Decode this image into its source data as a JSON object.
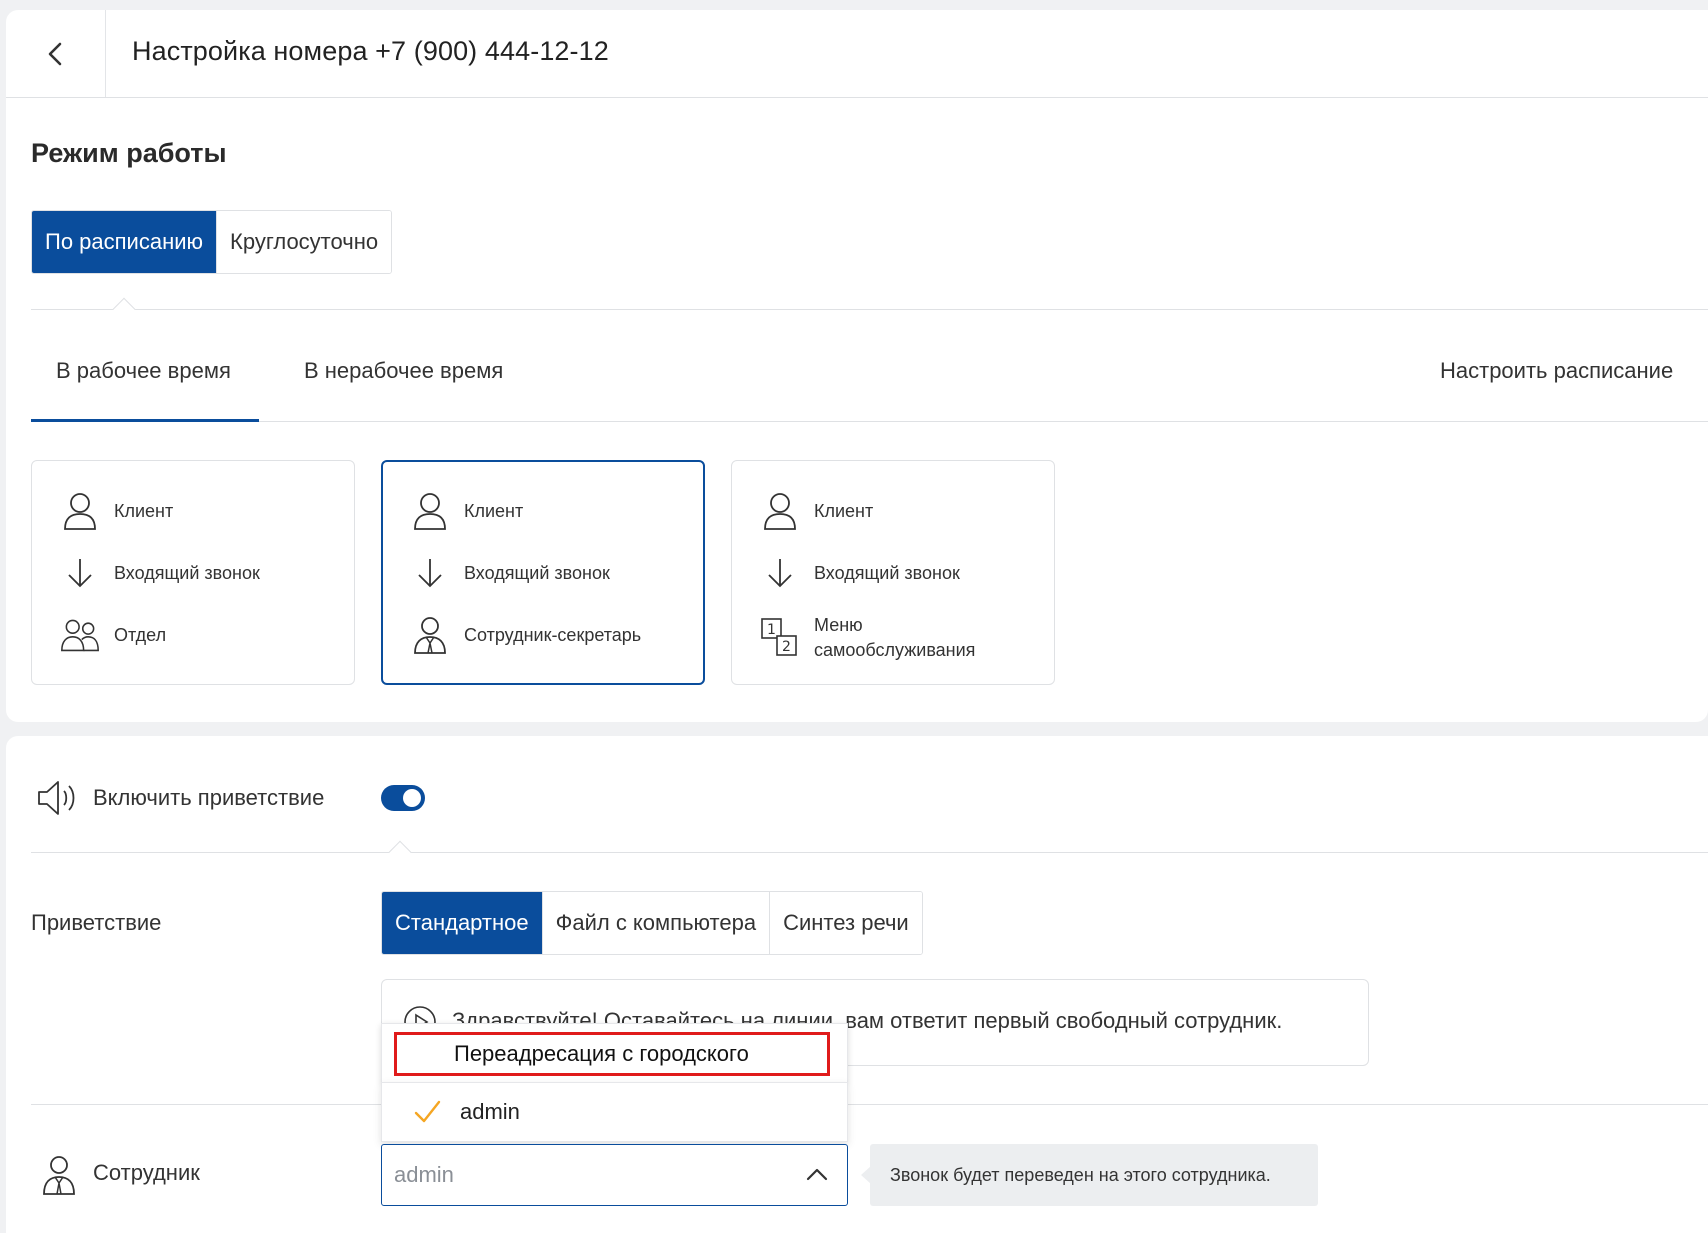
{
  "header": {
    "title": "Настройка номера +7 (900) 444-12-12"
  },
  "mode": {
    "title": "Режим работы",
    "options": [
      "По расписанию",
      "Круглосуточно"
    ]
  },
  "time_tabs": {
    "tabs": [
      "В рабочее время",
      "В нерабочее время"
    ],
    "configure_label": "Настроить расписание"
  },
  "scenarios": [
    {
      "rows": [
        "Клиент",
        "Входящий звонок",
        "Отдел"
      ],
      "icons": [
        "person-icon",
        "arrow-down-icon",
        "group-icon"
      ]
    },
    {
      "rows": [
        "Клиент",
        "Входящий звонок",
        "Сотрудник-секретарь"
      ],
      "icons": [
        "person-icon",
        "arrow-down-icon",
        "employee-icon"
      ]
    },
    {
      "rows": [
        "Клиент",
        "Входящий звонок",
        "Меню\nсамообслуживания"
      ],
      "icons": [
        "person-icon",
        "arrow-down-icon",
        "ivr-menu-icon"
      ]
    }
  ],
  "greeting": {
    "toggle_label": "Включить приветствие",
    "enabled": true,
    "label": "Приветствие",
    "source_options": [
      "Стандартное",
      "Файл с компьютера",
      "Синтез речи"
    ],
    "text": "Здравствуйте! Оставайтесь на линии, вам ответит первый свободный сотрудник."
  },
  "employee": {
    "label": "Сотрудник",
    "dropdown_group": "Переадресация с городского",
    "options": [
      "admin"
    ],
    "select_placeholder": "admin",
    "hint": "Звонок будет переведен на этого сотрудника."
  },
  "colors": {
    "accent": "#0a4d9c",
    "highlight": "#e01b1b",
    "check": "#f5a623"
  }
}
